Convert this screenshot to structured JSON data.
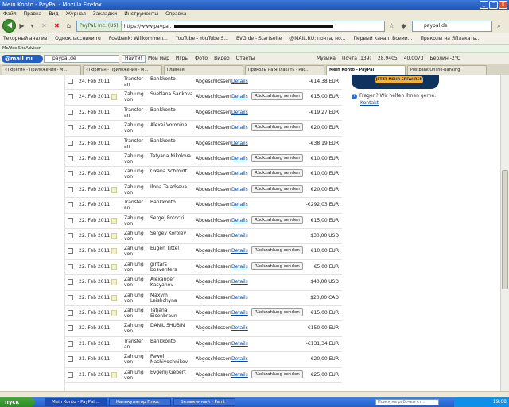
{
  "window": {
    "title": "Mein Konto - PayPal - Mozilla Firefox"
  },
  "menu": [
    "Файл",
    "Правка",
    "Вид",
    "Журнал",
    "Закладки",
    "Инструменты",
    "Справка"
  ],
  "nav": {
    "identity": "PayPal, Inc. (US)",
    "url": "https://www.paypal.",
    "search_value": "paypal.de"
  },
  "bookmarks": [
    "Текорный анализ",
    "Одноклассники.ru",
    "Postbank: Willkommen...",
    "YouTube - YouTube S...",
    "BVG.de - Startseite",
    "@MAIL.RU: почта, но...",
    "Первый канал. Всеми...",
    "Приколы на ЯПлакать..."
  ],
  "addon": {
    "label": "McAfee SiteAdvisor"
  },
  "mailbar": {
    "logo": "@mail.ru",
    "search": "paypal.de",
    "find": "Найти!",
    "items": [
      "Мой мир",
      "Игры",
      "Фото",
      "Видео",
      "Ответы",
      "Музыка"
    ],
    "right": [
      "Почта (139)",
      "28.9405",
      "40.0073",
      "Берлин -2°C"
    ]
  },
  "tabs": [
    {
      "label": "«Тюрягин - Приложения - М...",
      "active": false
    },
    {
      "label": "«Тюрягин - Приложения - М...",
      "active": false
    },
    {
      "label": "Главная",
      "active": false
    },
    {
      "label": "Приколы на ЯПлакать - Рас...",
      "active": false
    },
    {
      "label": "Mein Konto - PayPal",
      "active": true
    },
    {
      "label": "Postbank Online-Banking",
      "active": false
    }
  ],
  "transactions": [
    {
      "date": "24. Feb 2011",
      "note": false,
      "type": "Transfer an",
      "name": "Bankkonto",
      "status": "Abgeschlossen",
      "details": "Details",
      "refund": "",
      "amount": "-€14,38 EUR"
    },
    {
      "date": "24. Feb 2011",
      "note": true,
      "type": "Zahlung von",
      "name": "Svetlana Sankova",
      "status": "Abgeschlossen",
      "details": "Details",
      "refund": "Rückzahlung senden",
      "amount": "€15,00 EUR"
    },
    {
      "date": "22. Feb 2011",
      "note": false,
      "type": "Transfer an",
      "name": "Bankkonto",
      "status": "Abgeschlossen",
      "details": "Details",
      "refund": "",
      "amount": "-€19,27 EUR"
    },
    {
      "date": "22. Feb 2011",
      "note": false,
      "type": "Zahlung von",
      "name": "Alexei Voronine",
      "status": "Abgeschlossen",
      "details": "Details",
      "refund": "Rückzahlung senden",
      "amount": "€20,00 EUR"
    },
    {
      "date": "22. Feb 2011",
      "note": false,
      "type": "Transfer an",
      "name": "Bankkonto",
      "status": "Abgeschlossen",
      "details": "Details",
      "refund": "",
      "amount": "-€38,19 EUR"
    },
    {
      "date": "22. Feb 2011",
      "note": false,
      "type": "Zahlung von",
      "name": "Tatyana Nikolova",
      "status": "Abgeschlossen",
      "details": "Details",
      "refund": "Rückzahlung senden",
      "amount": "€10,00 EUR"
    },
    {
      "date": "22. Feb 2011",
      "note": false,
      "type": "Zahlung von",
      "name": "Oxana Schmidt",
      "status": "Abgeschlossen",
      "details": "Details",
      "refund": "Rückzahlung senden",
      "amount": "€10,00 EUR"
    },
    {
      "date": "22. Feb 2011",
      "note": true,
      "type": "Zahlung von",
      "name": "Ilona Taladseva",
      "status": "Abgeschlossen",
      "details": "Details",
      "refund": "Rückzahlung senden",
      "amount": "€20,00 EUR"
    },
    {
      "date": "22. Feb 2011",
      "note": false,
      "type": "Transfer an",
      "name": "Bankkonto",
      "status": "Abgeschlossen",
      "details": "Details",
      "refund": "",
      "amount": "-€292,03 EUR"
    },
    {
      "date": "22. Feb 2011",
      "note": true,
      "type": "Zahlung von",
      "name": "Sergej Potocki",
      "status": "Abgeschlossen",
      "details": "Details",
      "refund": "Rückzahlung senden",
      "amount": "€15,00 EUR"
    },
    {
      "date": "22. Feb 2011",
      "note": true,
      "type": "Zahlung von",
      "name": "Sergey Korolev",
      "status": "Abgeschlossen",
      "details": "Details",
      "refund": "",
      "amount": "$30,00 USD"
    },
    {
      "date": "22. Feb 2011",
      "note": true,
      "type": "Zahlung von",
      "name": "Eugen Tittel",
      "status": "Abgeschlossen",
      "details": "Details",
      "refund": "Rückzahlung senden",
      "amount": "€10,00 EUR"
    },
    {
      "date": "22. Feb 2011",
      "note": true,
      "type": "Zahlung von",
      "name": "gintars bosvehters",
      "status": "Abgeschlossen",
      "details": "Details",
      "refund": "Rückzahlung senden",
      "amount": "€5,00 EUR"
    },
    {
      "date": "22. Feb 2011",
      "note": true,
      "type": "Zahlung von",
      "name": "Alexander Kasyanov",
      "status": "Abgeschlossen",
      "details": "Details",
      "refund": "",
      "amount": "$40,00 USD"
    },
    {
      "date": "22. Feb 2011",
      "note": true,
      "type": "Zahlung von",
      "name": "Maxym Leishchyna",
      "status": "Abgeschlossen",
      "details": "Details",
      "refund": "",
      "amount": "$20,00 CAD"
    },
    {
      "date": "22. Feb 2011",
      "note": true,
      "type": "Zahlung von",
      "name": "Tatjana Eisenbraun",
      "status": "Abgeschlossen",
      "details": "Details",
      "refund": "Rückzahlung senden",
      "amount": "€15,00 EUR"
    },
    {
      "date": "22. Feb 2011",
      "note": false,
      "type": "Zahlung von",
      "name": "DANIL SHUBIN",
      "status": "Abgeschlossen",
      "details": "Details",
      "refund": "",
      "amount": "€150,00 EUR"
    },
    {
      "date": "21. Feb 2011",
      "note": false,
      "type": "Transfer an",
      "name": "Bankkonto",
      "status": "Abgeschlossen",
      "details": "Details",
      "refund": "",
      "amount": "-€131,34 EUR"
    },
    {
      "date": "21. Feb 2011",
      "note": false,
      "type": "Zahlung von",
      "name": "Pawel Nashivochnikov",
      "status": "Abgeschlossen",
      "details": "Details",
      "refund": "",
      "amount": "€20,00 EUR"
    },
    {
      "date": "21. Feb 2011",
      "note": true,
      "type": "Zahlung von",
      "name": "Evgenij Gebert",
      "status": "Abgeschlossen",
      "details": "Details",
      "refund": "Rückzahlung senden",
      "amount": "€25,00 EUR"
    }
  ],
  "sidebar": {
    "button": "JETZT MEHR ERFAHREN",
    "help": "Fragen? Wir helfen Ihnen gerne.",
    "contact": "Kontakt"
  },
  "taskbar": {
    "start": "пуск",
    "tasks": [
      {
        "label": "Mein Konto - PayPal ...",
        "active": true
      },
      {
        "label": "Калькулятор Плюс",
        "active": false
      },
      {
        "label": "Безымянный - Paint",
        "active": false
      }
    ],
    "search": "Поиск на рабочем ст...",
    "time": "19:08"
  }
}
